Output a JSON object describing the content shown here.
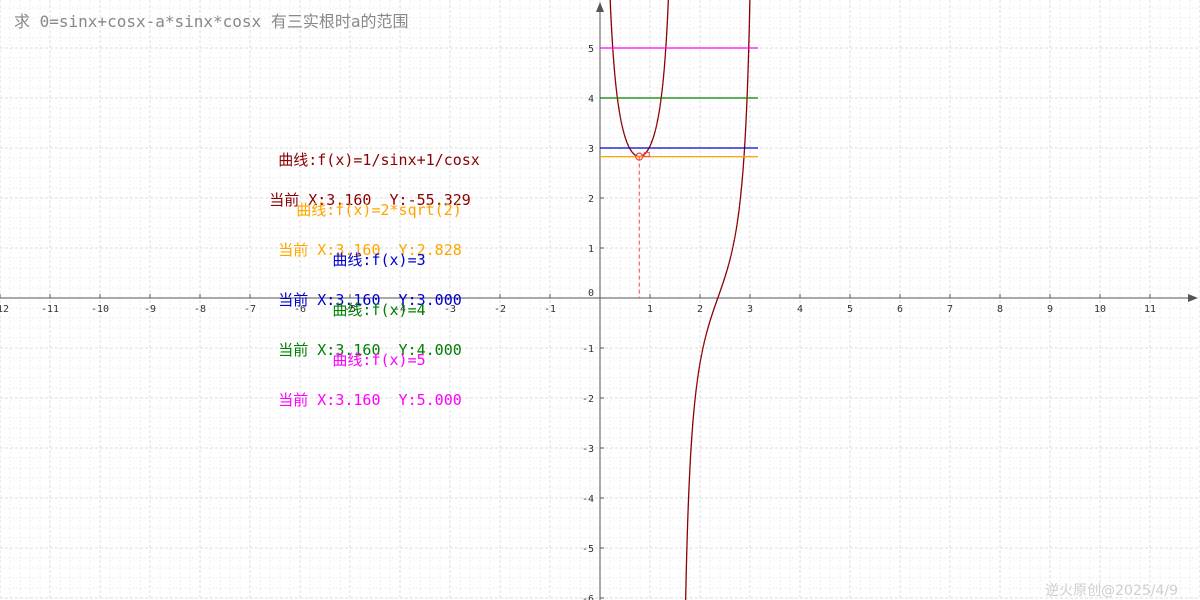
{
  "title": "求 0=sinx+cosx-a*sinx*cosx 有三实根时a的范围",
  "watermark": "逆火原创@2025/4/9",
  "curves": [
    {
      "label": "曲线:f(x)=1/sinx+1/cosx",
      "current": "当前 X:3.160  Y:-55.329",
      "color": "#8b0000"
    },
    {
      "label": "曲线:f(x)=2*sqrt(2)",
      "current": "当前 X:3.160  Y:2.828",
      "color": "#ffa500"
    },
    {
      "label": "曲线:f(x)=3",
      "current": "当前 X:3.160  Y:3.000",
      "color": "#0000cd"
    },
    {
      "label": "曲线:f(x)=4",
      "current": "当前 X:3.160  Y:4.000",
      "color": "#008000"
    },
    {
      "label": "曲线:f(x)=5",
      "current": "当前 X:3.160  Y:5.000",
      "color": "#ff00ff"
    }
  ],
  "chart_data": {
    "type": "line",
    "xlim": [
      -12,
      12
    ],
    "ylim": [
      -6,
      6
    ],
    "x_ticks": [
      -12,
      -11,
      -10,
      -9,
      -8,
      -7,
      -6,
      -5,
      -4,
      -3,
      -2,
      -1,
      1,
      2,
      3,
      4,
      5,
      6,
      7,
      8,
      9,
      10,
      11
    ],
    "y_ticks": [
      -6,
      -5,
      -4,
      -3,
      -2,
      -1,
      0,
      1,
      2,
      3,
      4,
      5
    ],
    "grid": true,
    "series": [
      {
        "name": "f(x)=1/sinx+1/cosx",
        "function": "1/sinx+1/cosx",
        "domain": [
          0,
          3.16
        ],
        "color": "#8b0000"
      },
      {
        "name": "f(x)=2*sqrt(2)",
        "constant": 2.828,
        "domain": [
          0,
          3.16
        ],
        "color": "#ffa500"
      },
      {
        "name": "f(x)=3",
        "constant": 3,
        "domain": [
          0,
          3.16
        ],
        "color": "#0000cd"
      },
      {
        "name": "f(x)=4",
        "constant": 4,
        "domain": [
          0,
          3.16
        ],
        "color": "#008000"
      },
      {
        "name": "f(x)=5",
        "constant": 5,
        "domain": [
          0,
          3.16
        ],
        "color": "#ff00ff"
      }
    ],
    "annotations": [
      {
        "type": "minimum-marker",
        "x": 0.785,
        "y": 2.828,
        "color": "#ff4444"
      }
    ]
  }
}
